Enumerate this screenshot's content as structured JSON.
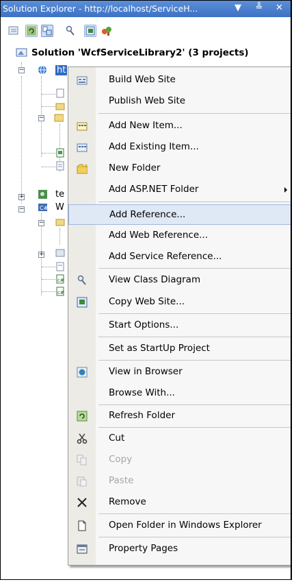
{
  "window": {
    "title": "Solution Explorer - http://localhost/ServiceH...",
    "dropdown_glyph": "▼",
    "pin_glyph": "ᵖ",
    "close_glyph": "✕"
  },
  "toolbar": {
    "buttons": [
      "properties-icon",
      "refresh-icon",
      "nest-related-files-icon",
      "view-class-diagram-icon",
      "copy-web-site-icon",
      "asp-net-configuration-icon"
    ]
  },
  "tree": {
    "solution_label": "Solution 'WcfServiceLibrary2' (3 projects)",
    "web_project_label": "ht",
    "test_project_label": "te",
    "wcf_project_label": "W"
  },
  "context_menu": {
    "items": [
      {
        "label": "Build Web Site",
        "icon": "build-icon"
      },
      {
        "label": "Publish Web Site",
        "icon": ""
      },
      {
        "label": "Add New Item...",
        "icon": "add-new-item-icon"
      },
      {
        "label": "Add Existing Item...",
        "icon": "add-existing-item-icon"
      },
      {
        "label": "New Folder",
        "icon": "new-folder-icon"
      },
      {
        "label": "Add ASP.NET Folder",
        "icon": "",
        "submenu": true
      },
      {
        "label": "Add Reference...",
        "icon": "",
        "highlighted": true
      },
      {
        "label": "Add Web Reference...",
        "icon": ""
      },
      {
        "label": "Add Service Reference...",
        "icon": ""
      },
      {
        "label": "View Class Diagram",
        "icon": "class-diagram-icon"
      },
      {
        "label": "Copy Web Site...",
        "icon": "copy-web-site-icon"
      },
      {
        "label": "Start Options...",
        "icon": ""
      },
      {
        "label": "Set as StartUp Project",
        "icon": ""
      },
      {
        "label": "View in Browser",
        "icon": "view-in-browser-icon"
      },
      {
        "label": "Browse With...",
        "icon": ""
      },
      {
        "label": "Refresh Folder",
        "icon": "refresh-icon"
      },
      {
        "label": "Cut",
        "icon": "cut-icon"
      },
      {
        "label": "Copy",
        "icon": "copy-icon",
        "disabled": true
      },
      {
        "label": "Paste",
        "icon": "paste-icon",
        "disabled": true
      },
      {
        "label": "Remove",
        "icon": "remove-icon"
      },
      {
        "label": "Open Folder in Windows Explorer",
        "icon": "open-folder-icon"
      },
      {
        "label": "Property Pages",
        "icon": "property-pages-icon"
      }
    ]
  }
}
